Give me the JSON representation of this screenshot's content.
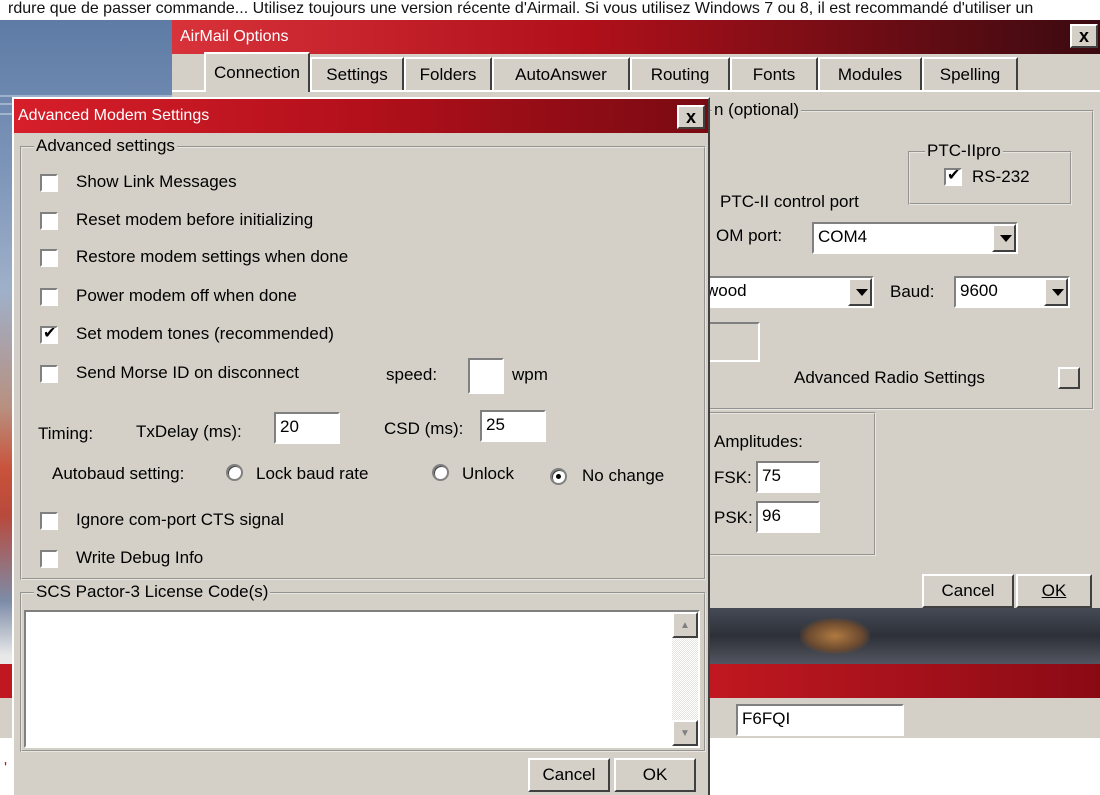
{
  "top_strip": "rdure que de passer commande... Utilisez toujours une version récente d'Airmail. Si vous utilisez Windows 7 ou 8, il est recommandé d'utiliser un",
  "airmail": {
    "title": "AirMail Options",
    "close": "x",
    "tabs": [
      "Connection",
      "Settings",
      "Folders",
      "AutoAnswer",
      "Routing",
      "Fonts",
      "Modules",
      "Spelling"
    ],
    "partial_group_title": "n (optional)",
    "ptc_group_title": "PTC-IIpro",
    "rs232": {
      "label": "RS-232",
      "checked": true
    },
    "control_port_label": "PTC-II control port",
    "com_port_label": "OM port:",
    "com_port_value": "COM4",
    "radio_value": "wood",
    "baud_label": "Baud:",
    "baud_value": "9600",
    "advanced_radio_label": "Advanced Radio Settings",
    "amplitudes_label": "Amplitudes:",
    "fsk_label": "FSK:",
    "fsk_value": "75",
    "psk_label": "PSK:",
    "psk_value": "96",
    "cancel_label": "Cancel",
    "ok_label": "OK",
    "callsign_value": "F6FQI"
  },
  "dialog": {
    "title": "Advanced Modem Settings",
    "close": "x",
    "group_title": "Advanced settings",
    "checkboxes": [
      {
        "label": "Show Link Messages",
        "checked": false
      },
      {
        "label": "Reset modem before initializing",
        "checked": false
      },
      {
        "label": "Restore modem settings when done",
        "checked": false
      },
      {
        "label": "Power modem off when done",
        "checked": false
      },
      {
        "label": "Set modem tones (recommended)",
        "checked": true
      },
      {
        "label": "Send Morse ID on disconnect",
        "checked": false
      }
    ],
    "speed_label": "speed:",
    "speed_value": "",
    "wpm_label": "wpm",
    "timing_label": "Timing:",
    "txdelay_label": "TxDelay (ms):",
    "txdelay_value": "20",
    "csd_label": "CSD (ms):",
    "csd_value": "25",
    "autobaud_label": "Autobaud setting:",
    "autobaud_options": [
      {
        "label": "Lock baud rate",
        "selected": false
      },
      {
        "label": "Unlock",
        "selected": false
      },
      {
        "label": "No change",
        "selected": true
      }
    ],
    "ignore_cts": {
      "label": "Ignore com-port CTS signal",
      "checked": false
    },
    "write_debug": {
      "label": "Write Debug Info",
      "checked": false
    },
    "license_group_title": "SCS Pactor-3 License Code(s)",
    "license_text": "",
    "cancel_label": "Cancel",
    "ok_label": "OK"
  }
}
